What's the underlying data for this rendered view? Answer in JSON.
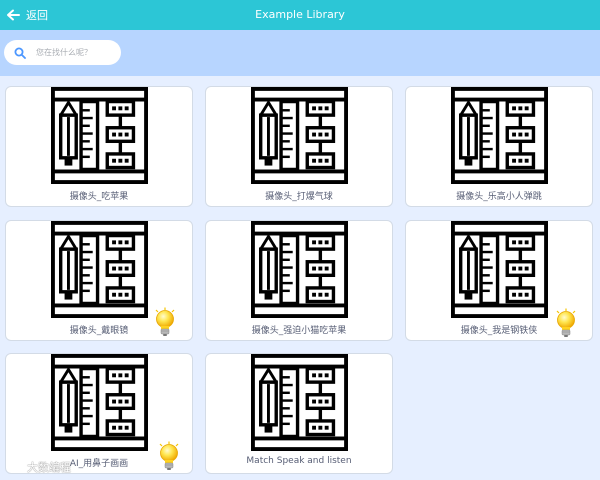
{
  "header": {
    "back_label": "返回",
    "title": "Example Library"
  },
  "search": {
    "placeholder": "您在找什么呢？"
  },
  "cards": [
    {
      "label": "摄像头_吃苹果"
    },
    {
      "label": "摄像头_打爆气球"
    },
    {
      "label": "摄像头_乐高小人弹跳"
    },
    {
      "label": "摄像头_戴眼镜"
    },
    {
      "label": "摄像头_强迫小猫吃苹果"
    },
    {
      "label": "摄像头_我是钢铁侠"
    },
    {
      "label": "AI_用鼻子画画"
    },
    {
      "label": "Match Speak and listen"
    }
  ],
  "watermark": {
    "text": "大数编程"
  },
  "colors": {
    "header": "#2cc6d6",
    "search_band": "#b7d5ff",
    "background": "#e6efff",
    "label_text": "#575e75"
  }
}
